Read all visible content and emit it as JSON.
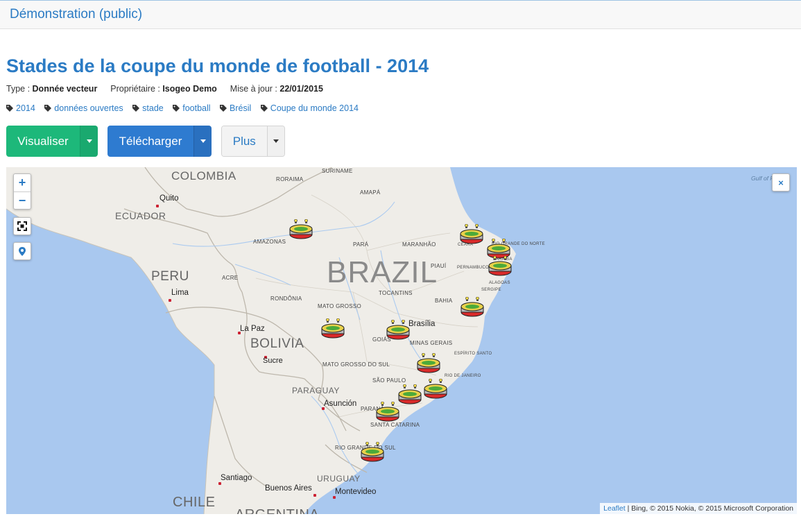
{
  "header": {
    "brand": "Démonstration (public)"
  },
  "dataset": {
    "title": "Stades de la coupe du monde de football - 2014",
    "type_label": "Type :",
    "type_value": "Donnée vecteur",
    "owner_label": "Propriétaire :",
    "owner_value": "Isogeo Demo",
    "updated_label": "Mise à jour :",
    "updated_value": "22/01/2015",
    "tags": [
      "2014",
      "données ouvertes",
      "stade",
      "football",
      "Brésil",
      "Coupe du monde 2014"
    ]
  },
  "actions": {
    "visualize": "Visualiser",
    "download": "Télécharger",
    "more": "Plus"
  },
  "map": {
    "zoom_in": "+",
    "zoom_out": "−",
    "close": "×",
    "countries": [
      "COLOMBIA",
      "ECUADOR",
      "PERU",
      "BOLIVIA",
      "PARAGUAY",
      "URUGUAY",
      "CHILE",
      "ARGENTINA",
      "SURINAME"
    ],
    "brazil_label": "BRAZIL",
    "states": [
      "RORAIMA",
      "AMAPÁ",
      "AMAZONAS",
      "PARÁ",
      "MARANHÃO",
      "CEARÁ",
      "RIO GRANDE DO NORTE",
      "PARAÍBA",
      "PIAUÍ",
      "PERNAMBUCO",
      "ALAGOAS",
      "SERGIPE",
      "ACRE",
      "RONDÔNIA",
      "TOCANTINS",
      "BAHIA",
      "MATO GROSSO",
      "GOIÁS",
      "MINAS GERAIS",
      "ESPÍRITO SANTO",
      "MATO GROSSO DO SUL",
      "SÃO PAULO",
      "RIO DE JANEIRO",
      "PARANÁ",
      "SANTA CATARINA",
      "RIO GRANDE DO SUL"
    ],
    "cities": [
      "Quito",
      "Lima",
      "La Paz",
      "Sucre",
      "Asunción",
      "Santiago",
      "Buenos Aires",
      "Montevideo",
      "Brasília"
    ],
    "ocean_label": "Gulf of Paria",
    "attribution_link": "Leaflet",
    "attribution_text": "| Bing, © 2015 Nokia, © 2015 Microsoft Corporation",
    "stadium_count": 12
  }
}
